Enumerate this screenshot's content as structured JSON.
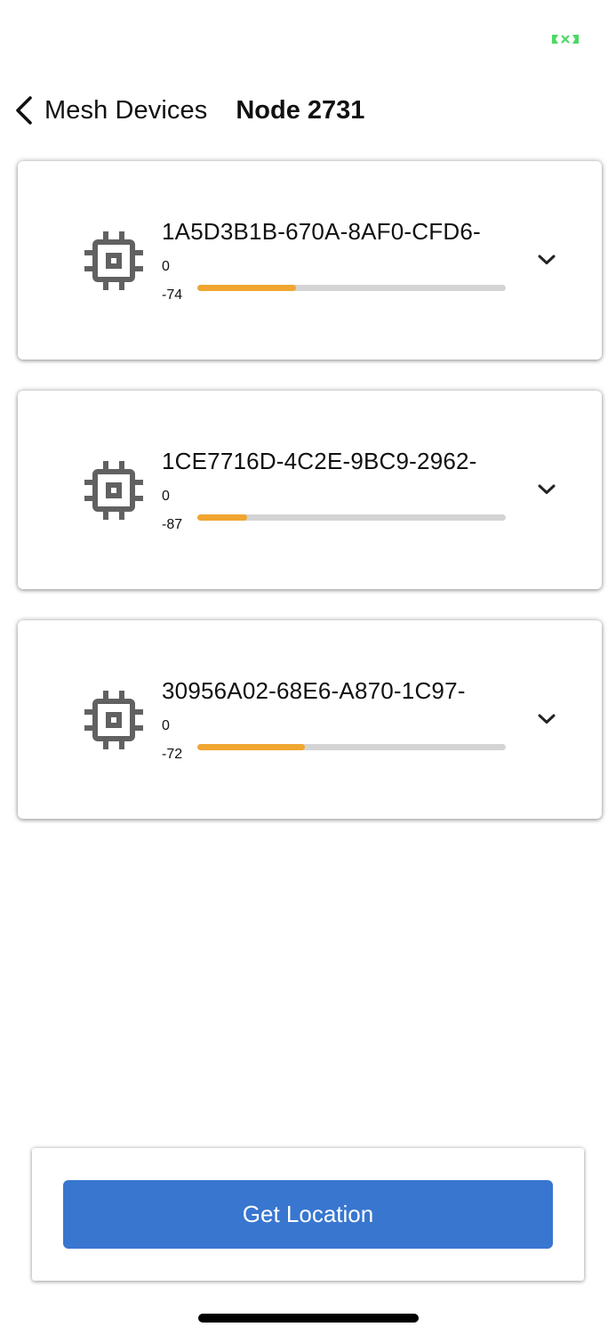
{
  "status_bar": {
    "indicator_icon": "battery-charging-icon",
    "indicator_color": "#4cd964"
  },
  "nav": {
    "back_icon": "chevron-left-icon",
    "back_label": "Mesh Devices",
    "title": "Node 2731"
  },
  "devices": [
    {
      "id": "1A5D3B1B-670A-8AF0-CFD6-",
      "signal_max": "0",
      "signal_value": "-74",
      "signal_level": 0.32,
      "icon": "chip-icon",
      "expand_icon": "chevron-down-icon"
    },
    {
      "id": "1CE7716D-4C2E-9BC9-2962-",
      "signal_max": "0",
      "signal_value": "-87",
      "signal_level": 0.16,
      "icon": "chip-icon",
      "expand_icon": "chevron-down-icon"
    },
    {
      "id": "30956A02-68E6-A870-1C97-",
      "signal_max": "0",
      "signal_value": "-72",
      "signal_level": 0.35,
      "icon": "chip-icon",
      "expand_icon": "chevron-down-icon"
    }
  ],
  "bottom_panel": {
    "button_label": "Get Location"
  },
  "colors": {
    "accent": "#3876d0",
    "signal_fill": "#f0a630",
    "signal_track": "#d4d4d4"
  }
}
